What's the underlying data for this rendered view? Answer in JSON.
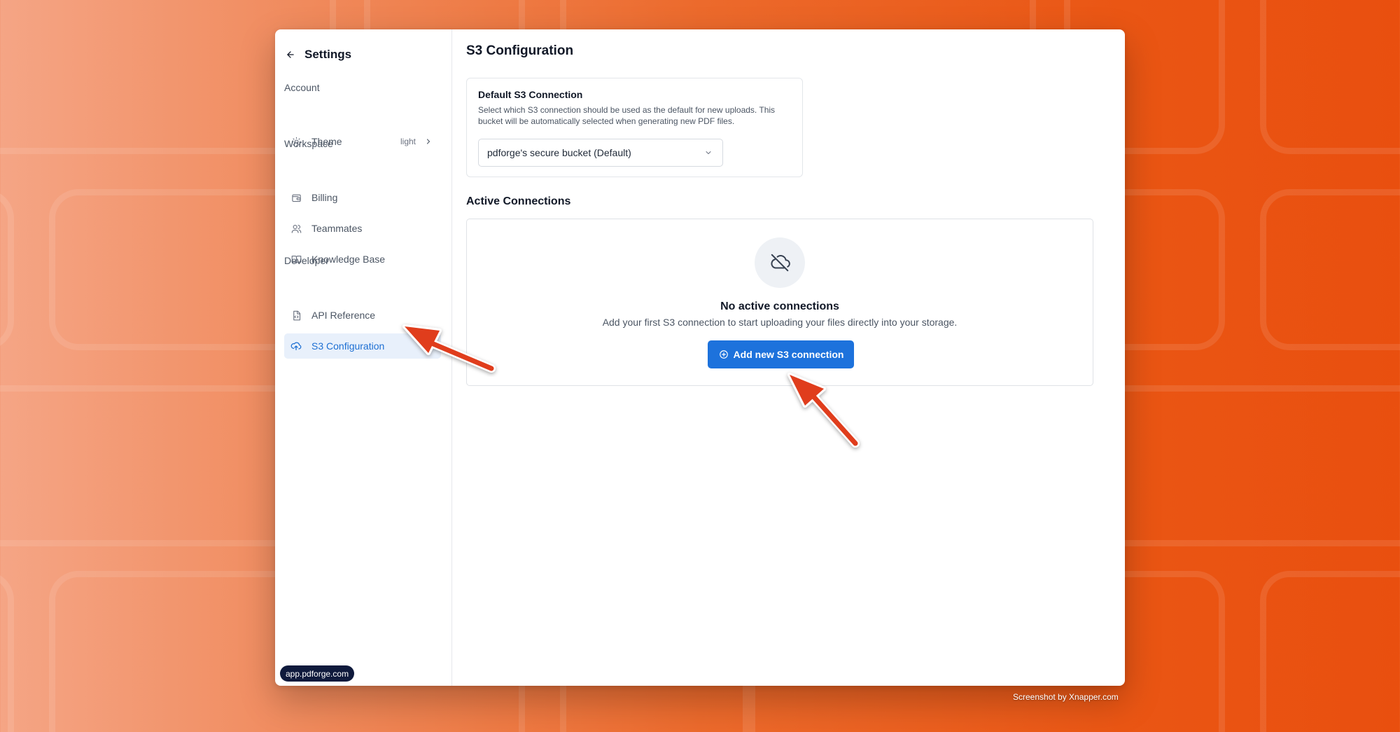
{
  "sidebar": {
    "back_icon": "arrow-left-icon",
    "title": "Settings",
    "sections": {
      "account": "Account",
      "workspace": "Workspace",
      "developer": "Developer"
    },
    "items": [
      {
        "label": "Theme",
        "icon": "sun-icon",
        "value": "light"
      },
      {
        "label": "Billing",
        "icon": "wallet-icon"
      },
      {
        "label": "Teammates",
        "icon": "users-icon"
      },
      {
        "label": "Knowledge Base",
        "icon": "book-open-icon"
      },
      {
        "label": "API Reference",
        "icon": "file-code-icon"
      },
      {
        "label": "S3 Configuration",
        "icon": "cloud-upload-icon",
        "active": true
      }
    ],
    "url_badge": "app.pdforge.com"
  },
  "main": {
    "title": "S3 Configuration",
    "default_connection": {
      "title": "Default S3 Connection",
      "description": "Select which S3 connection should be used as the default for new uploads. This bucket will be automatically selected when generating new PDF files.",
      "selected": "pdforge's secure bucket (Default)"
    },
    "active_connections": {
      "heading": "Active Connections",
      "empty_icon": "cloud-off-icon",
      "empty_title": "No active connections",
      "empty_description": "Add your first S3 connection to start uploading your files directly into your storage.",
      "add_button": "Add new S3 connection",
      "add_icon": "plus-circle-icon"
    }
  },
  "credit": "Screenshot by Xnapper.com",
  "colors": {
    "accent": "#1d72dc",
    "active_bg": "#e8f0fb",
    "arrow": "#e03e1f",
    "badge_bg": "#0f1a3c"
  }
}
